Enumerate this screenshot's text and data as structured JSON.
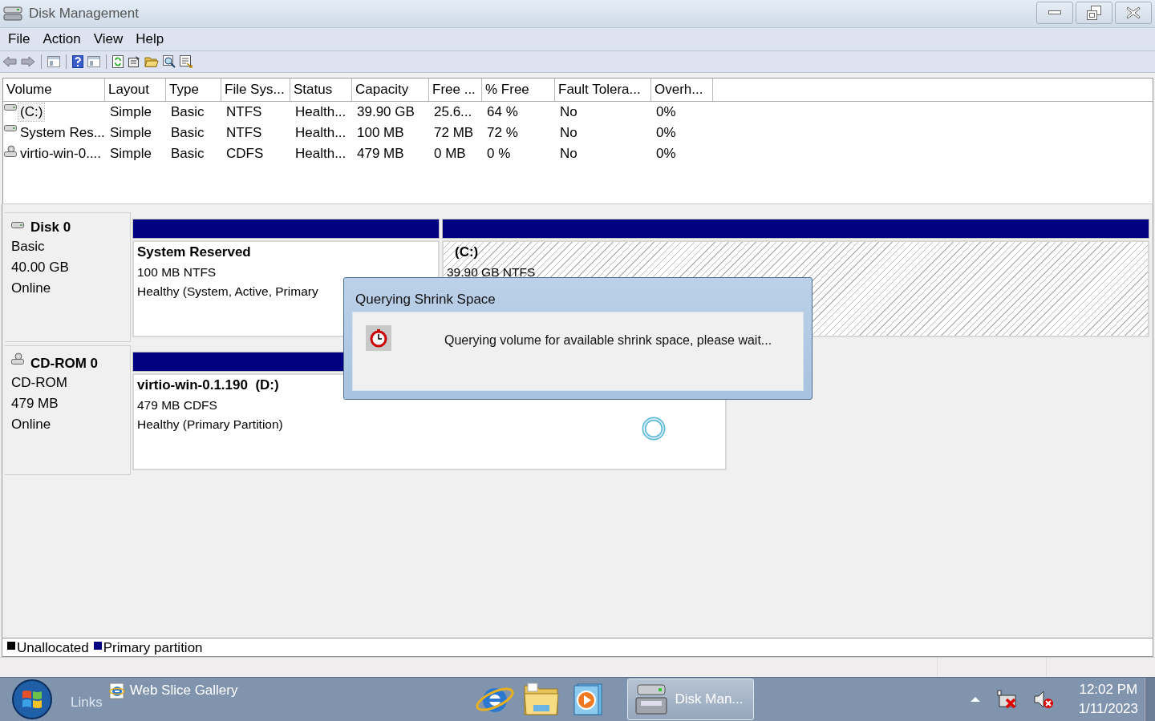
{
  "window": {
    "title": "Disk Management"
  },
  "menu": [
    "File",
    "Action",
    "View",
    "Help"
  ],
  "table": {
    "columns": [
      "Volume",
      "Layout",
      "Type",
      "File Sys...",
      "Status",
      "Capacity",
      "Free ...",
      "% Free",
      "Fault Tolera...",
      "Overh..."
    ],
    "rows": [
      {
        "kind": "disk",
        "selected": true,
        "cells": [
          "(C:)",
          "Simple",
          "Basic",
          "NTFS",
          "Health...",
          "39.90 GB",
          "25.6...",
          "64 %",
          "No",
          "0%"
        ]
      },
      {
        "kind": "disk",
        "selected": false,
        "cells": [
          "System Res...",
          "Simple",
          "Basic",
          "NTFS",
          "Health...",
          "100 MB",
          "72 MB",
          "72 %",
          "No",
          "0%"
        ]
      },
      {
        "kind": "cdrom",
        "selected": false,
        "cells": [
          "virtio-win-0....",
          "Simple",
          "Basic",
          "CDFS",
          "Health...",
          "479 MB",
          "0 MB",
          "0 %",
          "No",
          "0%"
        ]
      }
    ]
  },
  "disks": [
    {
      "kind": "disk",
      "name": "Disk 0",
      "details": [
        "Basic",
        "40.00 GB",
        "Online"
      ],
      "partitions": [
        {
          "name": "System Reserved",
          "size": "100 MB NTFS",
          "status": "Healthy (System, Active, Primary",
          "selected": false
        },
        {
          "name": "(C:)",
          "size": "39.90 GB NTFS",
          "selected": true
        }
      ]
    },
    {
      "kind": "cdrom",
      "name": "CD-ROM 0",
      "details": [
        "CD-ROM",
        "479 MB",
        "Online"
      ],
      "partitions": [
        {
          "name": "virtio-win-0.1.190  (D:)",
          "size": "479 MB CDFS",
          "status": "Healthy (Primary Partition)",
          "selected": false
        }
      ]
    }
  ],
  "legend": [
    {
      "label": "Unallocated",
      "color": "#000000"
    },
    {
      "label": "Primary partition",
      "color": "#000080"
    }
  ],
  "dialog": {
    "title": "Querying Shrink Space",
    "message": "Querying volume for available shrink space, please wait..."
  },
  "taskbar": {
    "links_label": "Links",
    "links": [
      "Web Slice Gallery"
    ],
    "tasks": [
      {
        "label": "Disk Man...",
        "selected": true
      }
    ],
    "time": "12:02 PM",
    "date": "1/11/2023"
  }
}
